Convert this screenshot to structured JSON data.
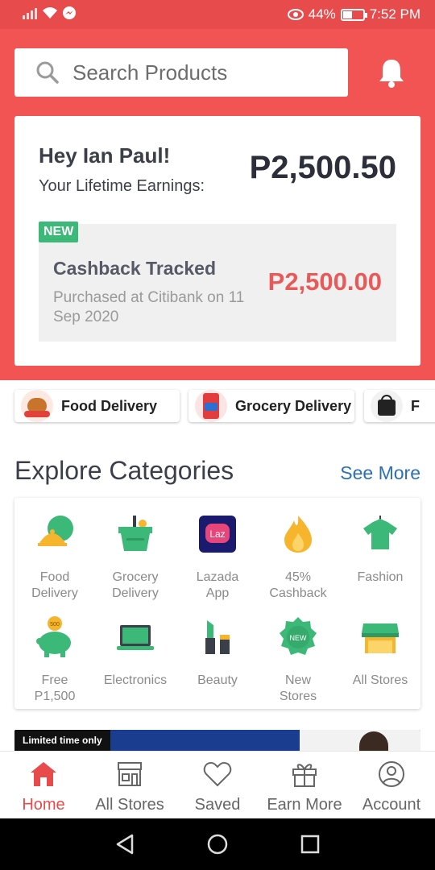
{
  "status_bar": {
    "battery": "44%",
    "battery_level": 0.44,
    "time": "7:52 PM"
  },
  "search": {
    "placeholder": "Search Products"
  },
  "earnings": {
    "greeting": "Hey Ian Paul!",
    "lifetime_label": "Your Lifetime Earnings:",
    "lifetime_amount": "P2,500.50",
    "badge": "NEW",
    "tracked_title": "Cashback Tracked",
    "tracked_desc": "Purchased at Citibank on 11 Sep 2020",
    "tracked_amount": "P2,500.00"
  },
  "shortcuts": [
    {
      "label": "Food Delivery",
      "icon": "fried-chicken-icon"
    },
    {
      "label": "Grocery Delivery",
      "icon": "detergent-icon"
    },
    {
      "label": "F",
      "icon": "bag-icon"
    }
  ],
  "explore": {
    "title": "Explore Categories",
    "see_more": "See More",
    "categories": [
      {
        "label": "Food\nDelivery",
        "icon": "food-delivery-icon"
      },
      {
        "label": "Grocery\nDelivery",
        "icon": "grocery-basket-icon"
      },
      {
        "label": "Lazada\nApp",
        "icon": "lazada-icon",
        "icon_text": "Laz"
      },
      {
        "label": "45%\nCashback",
        "icon": "flame-icon"
      },
      {
        "label": "Fashion",
        "icon": "shirt-icon"
      },
      {
        "label": "Free\nP1,500",
        "icon": "piggy-bank-icon",
        "icon_text": "500"
      },
      {
        "label": "Electronics",
        "icon": "laptop-icon"
      },
      {
        "label": "Beauty",
        "icon": "lipstick-icon"
      },
      {
        "label": "New\nStores",
        "icon": "new-badge-icon",
        "icon_text": "NEW"
      },
      {
        "label": "All Stores",
        "icon": "storefront-icon"
      }
    ]
  },
  "promo": {
    "tag": "Limited time only"
  },
  "bottom_nav": [
    {
      "label": "Home",
      "icon": "home-icon",
      "active": true
    },
    {
      "label": "All Stores",
      "icon": "store-icon",
      "active": false
    },
    {
      "label": "Saved",
      "icon": "heart-icon",
      "active": false
    },
    {
      "label": "Earn More",
      "icon": "gift-icon",
      "active": false
    },
    {
      "label": "Account",
      "icon": "account-icon",
      "active": false
    }
  ],
  "colors": {
    "brand_red": "#f25353",
    "accent_green": "#3cb878",
    "link_blue": "#2c6fb6"
  }
}
